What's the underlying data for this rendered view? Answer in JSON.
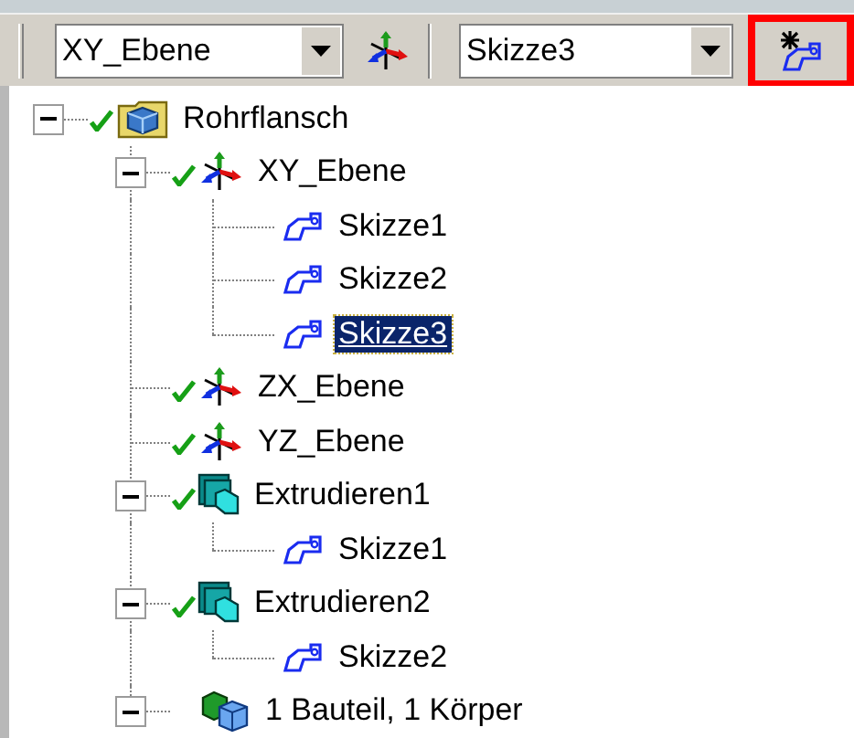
{
  "toolbar": {
    "plane_select": {
      "value": "XY_Ebene"
    },
    "sketch_select": {
      "value": "Skizze3"
    },
    "new_sketch_button": {
      "highlighted": true
    }
  },
  "tree": [
    {
      "label": "Rohrflansch",
      "kind": "part",
      "checked": true,
      "expanded": true,
      "selected": false,
      "children": [
        {
          "label": "XY_Ebene",
          "kind": "plane",
          "checked": true,
          "expanded": true,
          "selected": false,
          "children": [
            {
              "label": "Skizze1",
              "kind": "sketch",
              "checked": false,
              "selected": false
            },
            {
              "label": "Skizze2",
              "kind": "sketch",
              "checked": false,
              "selected": false
            },
            {
              "label": "Skizze3",
              "kind": "sketch",
              "checked": false,
              "selected": true
            }
          ]
        },
        {
          "label": "ZX_Ebene",
          "kind": "plane",
          "checked": true,
          "selected": false
        },
        {
          "label": "YZ_Ebene",
          "kind": "plane",
          "checked": true,
          "selected": false
        },
        {
          "label": "Extrudieren1",
          "kind": "extrude",
          "checked": true,
          "expanded": true,
          "selected": false,
          "children": [
            {
              "label": "Skizze1",
              "kind": "sketch",
              "checked": false,
              "selected": false
            }
          ]
        },
        {
          "label": "Extrudieren2",
          "kind": "extrude",
          "checked": true,
          "expanded": true,
          "selected": false,
          "children": [
            {
              "label": "Skizze2",
              "kind": "sketch",
              "checked": false,
              "selected": false
            }
          ]
        },
        {
          "label": "1 Bauteil, 1 Körper",
          "kind": "body",
          "checked": false,
          "expanded": true,
          "selected": false
        }
      ]
    }
  ]
}
